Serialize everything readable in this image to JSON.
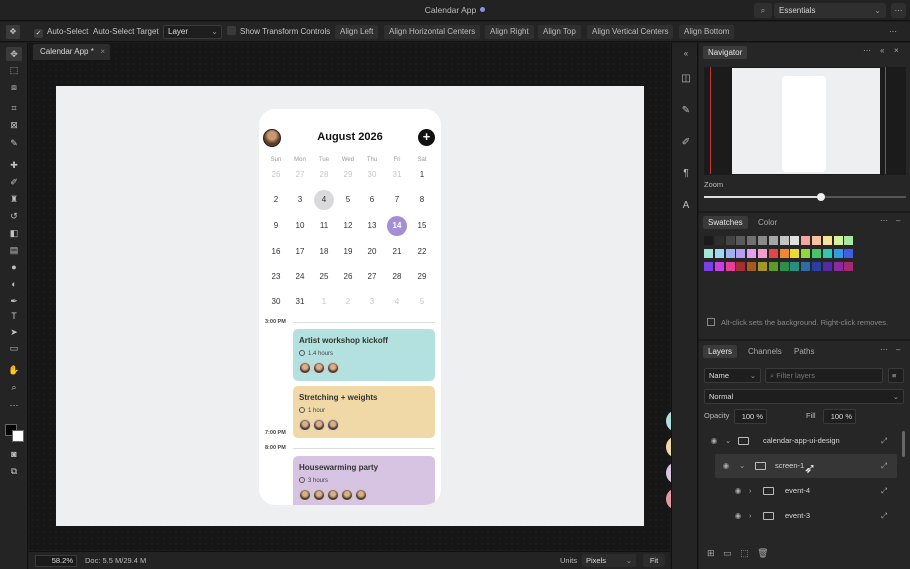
{
  "titlebar": {
    "title": "Calendar App",
    "workspace": "Essentials"
  },
  "options": {
    "auto_select": "Auto-Select",
    "auto_select_target": "Auto-Select Target",
    "target_value": "Layer",
    "show_transform": "Show Transform Controls",
    "align": [
      "Align Left",
      "Align Horizontal Centers",
      "Align Right",
      "Align Top",
      "Align Vertical Centers",
      "Align Bottom"
    ]
  },
  "document": {
    "tab_label": "Calendar App *"
  },
  "calendar": {
    "month": "August 2026",
    "weekdays": [
      "Sun",
      "Mon",
      "Tue",
      "Wed",
      "Thu",
      "Fri",
      "Sat"
    ],
    "weeks": [
      [
        "26",
        "27",
        "28",
        "29",
        "30",
        "31",
        "1"
      ],
      [
        "2",
        "3",
        "4",
        "5",
        "6",
        "7",
        "8"
      ],
      [
        "9",
        "10",
        "11",
        "12",
        "13",
        "14",
        "15"
      ],
      [
        "16",
        "17",
        "18",
        "19",
        "20",
        "21",
        "22"
      ],
      [
        "23",
        "24",
        "25",
        "26",
        "27",
        "28",
        "29"
      ],
      [
        "30",
        "31",
        "1",
        "2",
        "3",
        "4",
        "5"
      ]
    ],
    "times": [
      "3:00 PM",
      "7:00 PM",
      "8:00 PM"
    ],
    "events": [
      {
        "title": "Artist workshop kickoff",
        "duration": "1.4 hours",
        "color": "#b3e1df"
      },
      {
        "title": "Stretching + weights",
        "duration": "1 hour",
        "color": "#f0d9a7"
      },
      {
        "title": "Housewarming party",
        "duration": "3 hours",
        "color": "#d7c4e3"
      }
    ],
    "palette": [
      "#aee0dd",
      "#f1d9a4",
      "#d8c6e4",
      "#e69aa0"
    ]
  },
  "status": {
    "zoom": "58.2%",
    "doc": "Doc: 5.5 M/29.4 M",
    "units_label": "Units",
    "units_value": "Pixels",
    "fit": "Fit"
  },
  "panels": {
    "navigator": {
      "tab": "Navigator",
      "zoom_label": "Zoom",
      "zoom_level": 0.58
    },
    "swatches": {
      "tabs": [
        "Swatches",
        "Color"
      ],
      "hint": "Alt-click sets the background. Right-click removes."
    },
    "layers": {
      "tabs": [
        "Layers",
        "Channels",
        "Paths"
      ],
      "filter_kind": "Name",
      "filter_placeholder": "Filter layers",
      "blend_mode": "Normal",
      "opacity_label": "Opacity",
      "opacity_value": "100 %",
      "fill_label": "Fill",
      "fill_value": "100 %",
      "items": [
        "calendar-app-ui-design",
        "screen-1",
        "event-4",
        "event-3"
      ]
    }
  },
  "swatch_colors": [
    "#1a1a1a",
    "#2e2e2e",
    "#444444",
    "#5a5a5a",
    "#707070",
    "#8a8a8a",
    "#a6a6a6",
    "#c3c3c3",
    "#e0e0e0",
    "#f5a3a3",
    "#f7c19b",
    "#f5e39a",
    "#d8f09a",
    "#a7e9a0",
    "#a1e6d7",
    "#9fd6f2",
    "#9fb3f2",
    "#b59ff2",
    "#e49ff2",
    "#f29fd0",
    "#e64545",
    "#f0882e",
    "#eadc33",
    "#8fd93f",
    "#3fc96a",
    "#2fc9b3",
    "#2f9be6",
    "#3f5de6",
    "#7a3fe6",
    "#c93fe6",
    "#e63f9b",
    "#a33030",
    "#a35b1f",
    "#a3972a",
    "#5e9a2a",
    "#2a8f4b",
    "#2a8f80",
    "#2a6ea3",
    "#2a3fa3",
    "#552aa3",
    "#8c2aa3",
    "#a32a6e"
  ]
}
